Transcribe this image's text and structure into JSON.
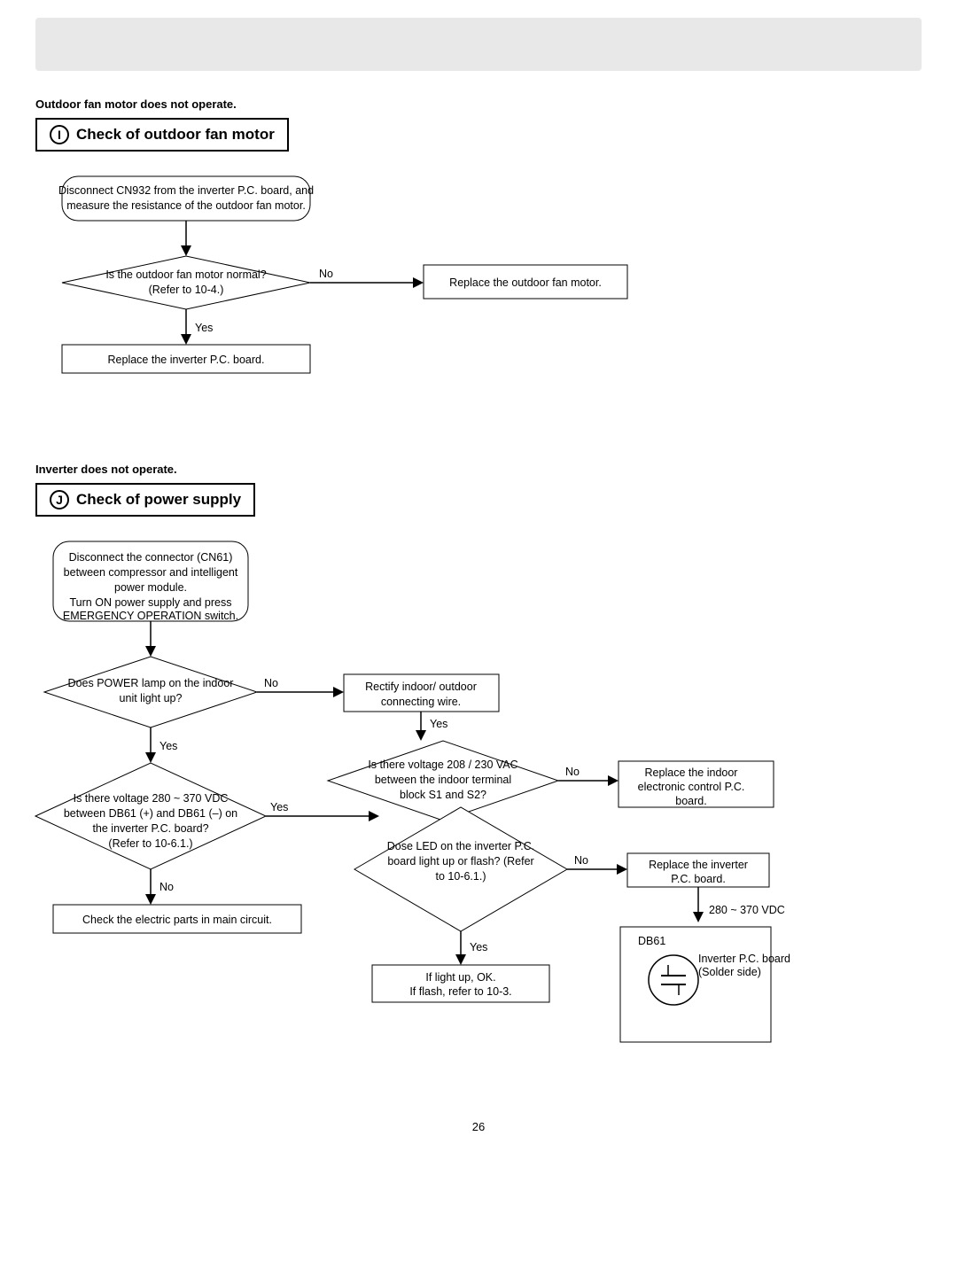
{
  "page": {
    "number": "26",
    "header_bg": "#e0e0e0"
  },
  "section_i": {
    "fault_label": "Outdoor fan motor does not operate.",
    "circle_letter": "I",
    "title": "Check of outdoor fan motor",
    "step1": "Disconnect CN932 from the inverter P.C. board, and\nmeasure the resistance of the outdoor fan motor.",
    "question1": "Is the outdoor fan motor normal?\n(Refer to 10-4.)",
    "no_label": "No",
    "yes_label": "Yes",
    "action_no": "Replace the outdoor fan motor.",
    "action_yes": "Replace the inverter P.C. board."
  },
  "section_j": {
    "fault_label": "Inverter does not operate.",
    "circle_letter": "J",
    "title": "Check of power supply",
    "step1_line1": "Disconnect the connector (CN61)",
    "step1_line2": "between compressor and intelligent",
    "step1_line3": "power module.",
    "step1_line4": "Turn ON power supply and press",
    "step1_line5": "EMERGENCY OPERATION switch.",
    "question1_line1": "Does POWER lamp on the indoor",
    "question1_line2": "unit light up?",
    "no1_label": "No",
    "yes1_label": "Yes",
    "action_rectify_line1": "Rectify indoor/ outdoor",
    "action_rectify_line2": "connecting wire.",
    "yes2_label": "Yes",
    "question2_line1": "Is there voltage 208 / 230 VAC",
    "question2_line2": "between the indoor terminal",
    "question2_line3": "block S1 and S2?",
    "no2_label": "No",
    "action_replace_indoor_line1": "Replace the indoor",
    "action_replace_indoor_line2": "electronic control P.C.",
    "action_replace_indoor_line3": "board.",
    "question3_line1": "Is there voltage 280 ~ 370 VDC",
    "question3_line2": "between DB61 (+) and DB61 (–) on",
    "question3_line3": "the inverter P.C. board?",
    "question3_line4": "(Refer to 10-6.1.)",
    "yes3_label": "Yes",
    "question4_line1": "Dose LED on the inverter P.C.",
    "question4_line2": "board light up or flash? (Refer",
    "question4_line3": "to 10-6.1.)",
    "no3_label": "No",
    "action_replace_inverter_line1": "Replace the inverter",
    "action_replace_inverter_line2": "P.C. board.",
    "no4_label": "No",
    "action_check_electric": "Check the electric parts in main circuit.",
    "yes4_label": "Yes",
    "action_light_up_line1": "If light up, OK.",
    "action_light_up_line2": "If flash, refer to 10-3.",
    "voltage_label": "280 ~ 370 VDC",
    "db61_label": "DB61",
    "board_label_line1": "Inverter P.C. board",
    "board_label_line2": "(Solder side)"
  }
}
